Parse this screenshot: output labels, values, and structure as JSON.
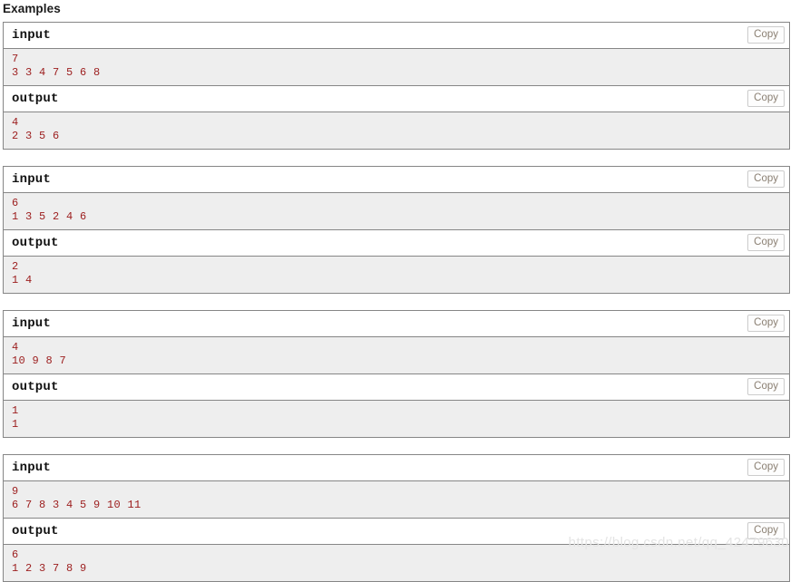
{
  "page": {
    "title": "Examples",
    "watermark": "https://blog.csdn.net/qq_42479630",
    "colors": {
      "io_text": "#9c1d1d",
      "content_bg": "#eeeeee",
      "border": "#868686",
      "copy_text": "#8a7f72",
      "copy_border": "#cccccc",
      "watermark": "#e4e4e4"
    }
  },
  "copy_label": "Copy",
  "examples": [
    {
      "input": {
        "label": "input",
        "copy_label": "Copy",
        "lines": [
          "7",
          "3 3 4 7 5 6 8"
        ]
      },
      "output": {
        "label": "output",
        "copy_label": "Copy",
        "lines": [
          "4",
          "2 3 5 6"
        ]
      }
    },
    {
      "input": {
        "label": "input",
        "copy_label": "Copy",
        "lines": [
          "6",
          "1 3 5 2 4 6"
        ]
      },
      "output": {
        "label": "output",
        "copy_label": "Copy",
        "lines": [
          "2",
          "1 4"
        ]
      }
    },
    {
      "input": {
        "label": "input",
        "copy_label": "Copy",
        "lines": [
          "4",
          "10 9 8 7"
        ]
      },
      "output": {
        "label": "output",
        "copy_label": "Copy",
        "lines": [
          "1",
          "1"
        ]
      }
    },
    {
      "input": {
        "label": "input",
        "copy_label": "Copy",
        "lines": [
          "9",
          "6 7 8 3 4 5 9 10 11"
        ]
      },
      "output": {
        "label": "output",
        "copy_label": "Copy",
        "lines": [
          "6",
          "1 2 3 7 8 9"
        ]
      }
    }
  ]
}
